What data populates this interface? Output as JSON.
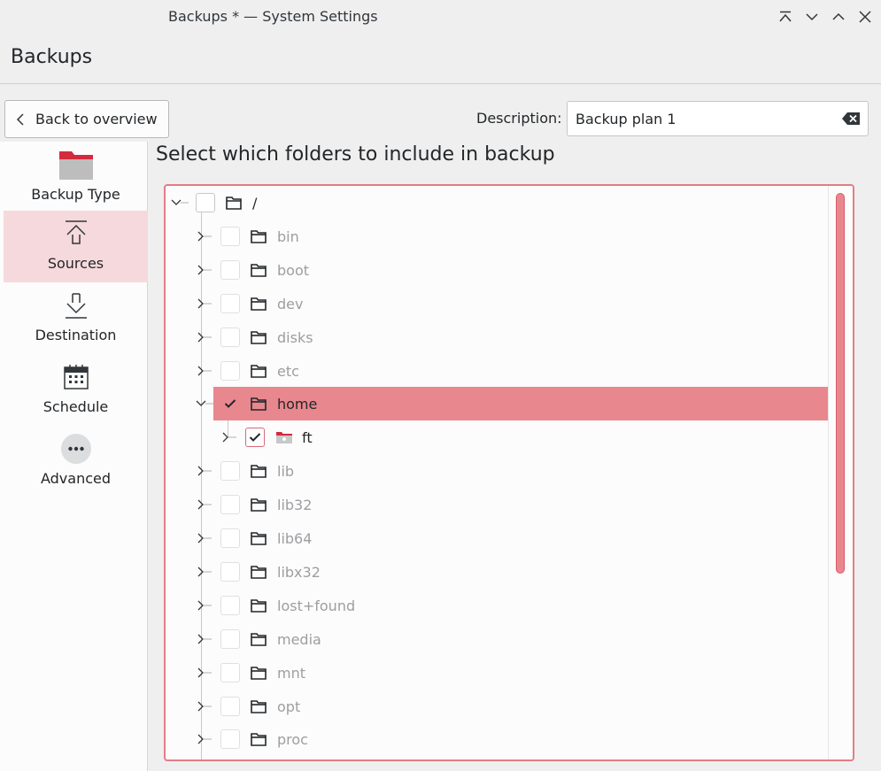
{
  "window": {
    "title": "Backups * — System Settings"
  },
  "page": {
    "title": "Backups"
  },
  "toolbar": {
    "back_label": "Back to overview",
    "description_label": "Description:",
    "description_value": "Backup plan 1"
  },
  "sidebar": {
    "items": [
      {
        "label": "Backup Type",
        "icon": "folder-red-icon",
        "active": false
      },
      {
        "label": "Sources",
        "icon": "upload-icon",
        "active": true
      },
      {
        "label": "Destination",
        "icon": "download-icon",
        "active": false
      },
      {
        "label": "Schedule",
        "icon": "calendar-icon",
        "active": false
      },
      {
        "label": "Advanced",
        "icon": "more-icon",
        "active": false
      }
    ]
  },
  "main": {
    "heading": "Select which folders to include in backup"
  },
  "tree": {
    "root": {
      "label": "/",
      "expanded": true,
      "checked": false
    },
    "children": [
      {
        "label": "bin",
        "checked": false,
        "dim": true
      },
      {
        "label": "boot",
        "checked": false,
        "dim": true
      },
      {
        "label": "dev",
        "checked": false,
        "dim": true
      },
      {
        "label": "disks",
        "checked": false,
        "dim": true
      },
      {
        "label": "etc",
        "checked": false,
        "dim": true
      },
      {
        "label": "home",
        "checked": true,
        "dim": false,
        "expanded": true,
        "selected": true
      },
      {
        "label": "ft",
        "checked": true,
        "dim": false,
        "nested": true,
        "user_folder": true
      },
      {
        "label": "lib",
        "checked": false,
        "dim": true
      },
      {
        "label": "lib32",
        "checked": false,
        "dim": true
      },
      {
        "label": "lib64",
        "checked": false,
        "dim": true
      },
      {
        "label": "libx32",
        "checked": false,
        "dim": true
      },
      {
        "label": "lost+found",
        "checked": false,
        "dim": true
      },
      {
        "label": "media",
        "checked": false,
        "dim": true
      },
      {
        "label": "mnt",
        "checked": false,
        "dim": true
      },
      {
        "label": "opt",
        "checked": false,
        "dim": true
      },
      {
        "label": "proc",
        "checked": false,
        "dim": true
      }
    ]
  },
  "colors": {
    "accent": "#e8878e",
    "accent_border": "#d85c69",
    "selected_bg": "#f6d9dc"
  }
}
